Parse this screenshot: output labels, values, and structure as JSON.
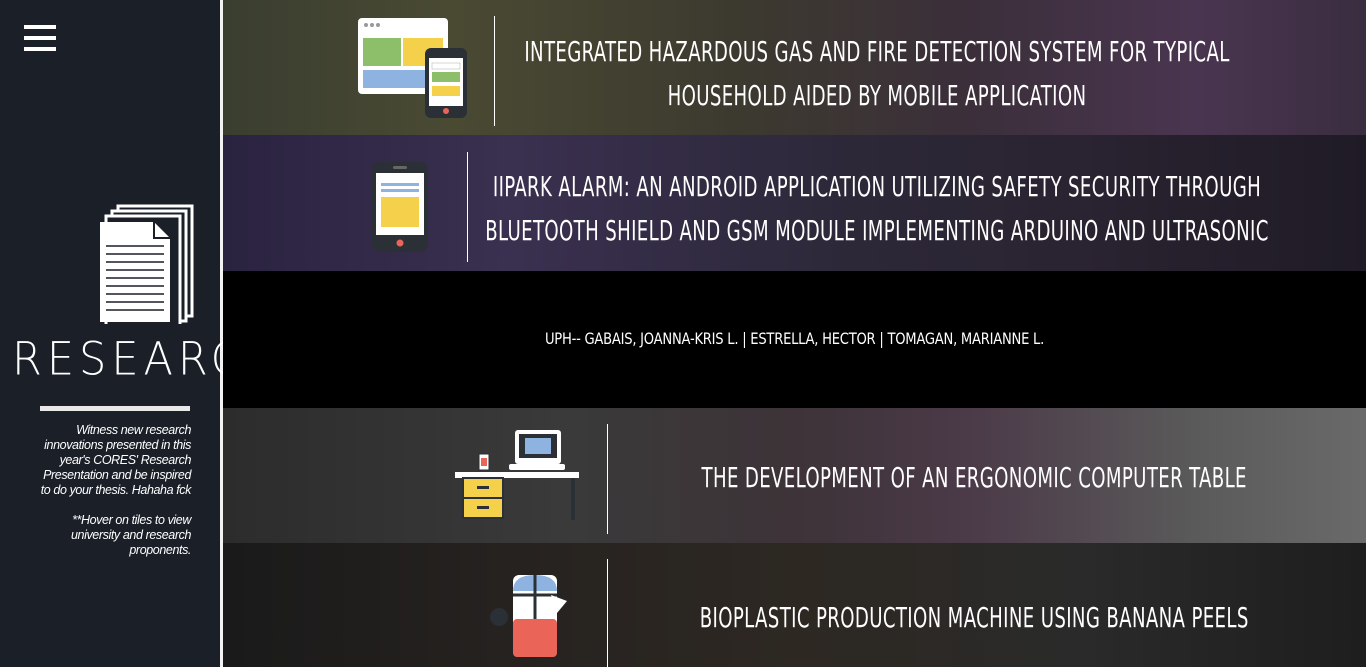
{
  "sidebar": {
    "menu_icon": "hamburger-icon",
    "section_icon": "documents-icon",
    "title": "RESEARCH",
    "description": "Witness new research innovations presented in this year's CORES' Research Presentation and be inspired to do your thesis. Hahaha fck",
    "hint": "**Hover on tiles to view university and research proponents."
  },
  "tiles": [
    {
      "icon": "web-mobile-app-icon",
      "title_line1": "Integrated Hazardous Gas and Fire Detection System for Typical",
      "title_line2": "Household aided by Mobile Application"
    },
    {
      "icon": "smartphone-icon",
      "title_line1": "iIPark Alarm: An Android Application Utilizing Safety Security Through",
      "title_line2": "Bluetooth Shield and GSM Module Implementing Arduino and Ultrasonic"
    },
    {
      "proponents": "UPH-- Gabais, Joanna-Kris L. | Estrella, Hector | Tomagan, Marianne L."
    },
    {
      "icon": "computer-desk-icon",
      "title_line1": "The Development of an Ergonomic Computer Table"
    },
    {
      "icon": "machine-icon",
      "title_line1": "Bioplastic Production Machine Using Banana Peels"
    }
  ],
  "colors": {
    "sidebar_bg": "#1a1f28",
    "accent_yellow": "#f5d04a",
    "accent_green": "#8dbf6a",
    "accent_blue": "#8fb3e0",
    "accent_red": "#ea6557"
  }
}
